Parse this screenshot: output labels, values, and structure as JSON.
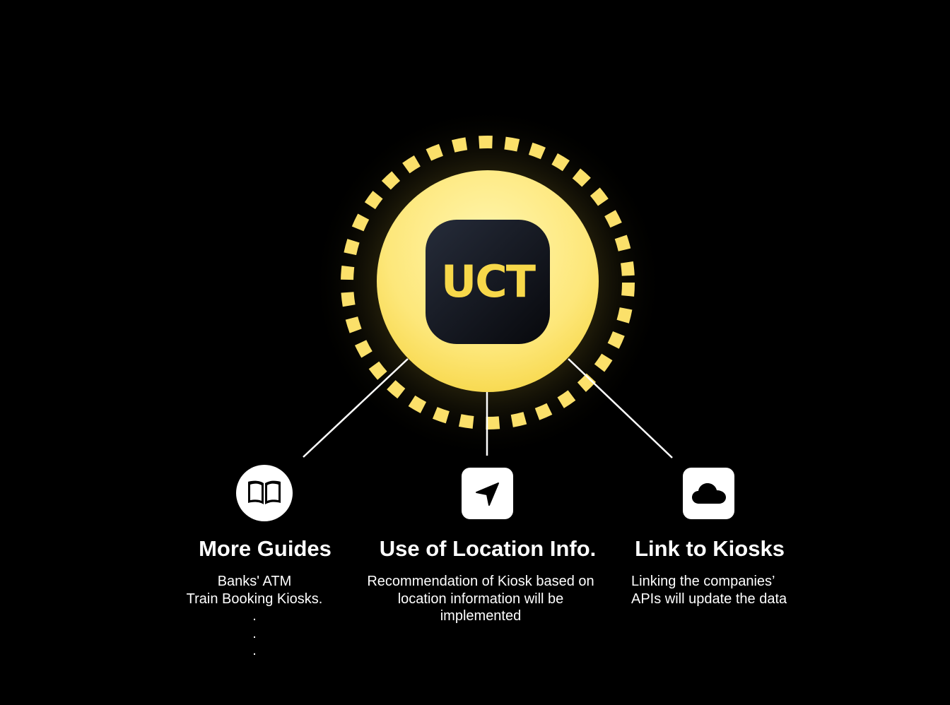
{
  "logo": {
    "text": "UCT",
    "icon": "uct-app-icon",
    "colors": {
      "accent_yellow": "#f7d84a",
      "badge_dark": "#12151d",
      "ring_yellow": "#fbe06a"
    }
  },
  "features": [
    {
      "icon": "book-icon",
      "title": "More Guides",
      "description": [
        "Banks' ATM",
        "Train Booking Kiosks.",
        ".",
        ".",
        "."
      ]
    },
    {
      "icon": "location-arrow-icon",
      "title": "Use of Location Info.",
      "description": [
        "Recommendation of Kiosk based on",
        "location information will be",
        "implemented"
      ]
    },
    {
      "icon": "cloud-icon",
      "title": "Link to Kiosks",
      "description": [
        "Linking the companies’",
        "APIs will update the data"
      ]
    }
  ]
}
